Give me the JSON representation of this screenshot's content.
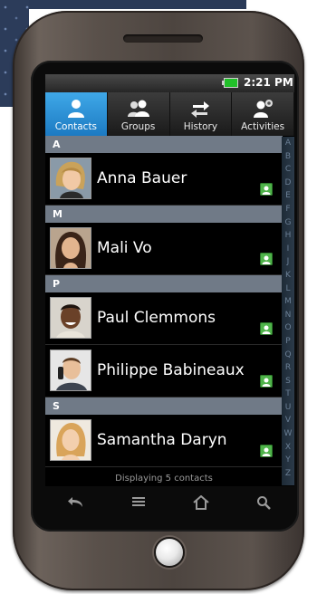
{
  "status": {
    "time": "2:21 PM"
  },
  "tabs": [
    {
      "label": "Contacts",
      "icon": "person-icon",
      "active": true
    },
    {
      "label": "Groups",
      "icon": "people-icon",
      "active": false
    },
    {
      "label": "History",
      "icon": "arrows-icon",
      "active": false
    },
    {
      "label": "Activities",
      "icon": "person-star-icon",
      "active": false
    }
  ],
  "sections": [
    {
      "letter": "A",
      "contacts": [
        {
          "name": "Anna Bauer",
          "avatar": "woman-short-hair-avatar"
        }
      ]
    },
    {
      "letter": "M",
      "contacts": [
        {
          "name": "Mali Vo",
          "avatar": "woman-long-hair-avatar"
        }
      ]
    },
    {
      "letter": "P",
      "contacts": [
        {
          "name": "Paul Clemmons",
          "avatar": "smiling-man-avatar"
        },
        {
          "name": "Philippe Babineaux",
          "avatar": "man-phone-avatar"
        }
      ]
    },
    {
      "letter": "S",
      "contacts": [
        {
          "name": "Samantha Daryn",
          "avatar": "woman-blonde-avatar"
        }
      ]
    }
  ],
  "alphabet": [
    "A",
    "B",
    "C",
    "D",
    "E",
    "F",
    "G",
    "H",
    "I",
    "J",
    "K",
    "L",
    "M",
    "N",
    "O",
    "P",
    "Q",
    "R",
    "S",
    "T",
    "U",
    "V",
    "W",
    "X",
    "Y",
    "Z"
  ],
  "footer": "Displaying 5 contacts",
  "nav": [
    "back-icon",
    "menu-icon",
    "home-icon",
    "search-icon"
  ],
  "colors": {
    "accent": "#2a8fd6",
    "section_bar": "#707a87",
    "badge": "#4fb34a",
    "battery": "#22c02a"
  }
}
